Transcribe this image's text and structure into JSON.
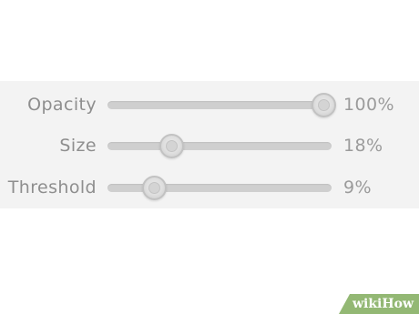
{
  "sliders": [
    {
      "label": "Opacity",
      "value_text": "100%",
      "value": 100,
      "min": 0,
      "max": 100
    },
    {
      "label": "Size",
      "value_text": "18%",
      "value": 18,
      "min": 0,
      "max": 100
    },
    {
      "label": "Threshold",
      "value_text": "9%",
      "value": 9,
      "min": 0,
      "max": 100
    }
  ],
  "watermark": {
    "text": "wikiHow",
    "color": "#93b874"
  }
}
